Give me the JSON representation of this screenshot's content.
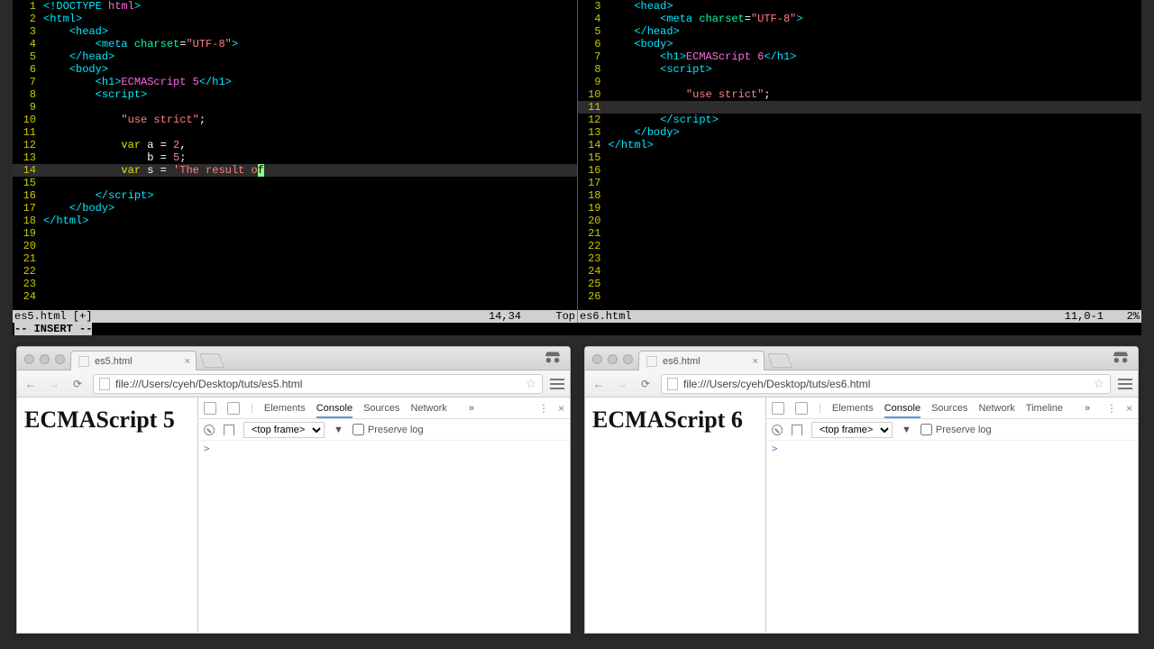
{
  "vim": {
    "left": {
      "lines": [
        {
          "n": 1,
          "html": "<span class='ang'>&lt;!</span><span class='tag'>DOCTYPE</span> <span class='mag'>html</span><span class='ang'>&gt;</span>"
        },
        {
          "n": 2,
          "html": "<span class='ang'>&lt;</span><span class='tag'>html</span><span class='ang'>&gt;</span>"
        },
        {
          "n": 3,
          "html": "    <span class='ang'>&lt;</span><span class='tag'>head</span><span class='ang'>&gt;</span>"
        },
        {
          "n": 4,
          "html": "        <span class='ang'>&lt;</span><span class='tag'>meta</span> <span class='attr'>charset</span><span class='white'>=</span><span class='str'>\"UTF-8\"</span><span class='ang'>&gt;</span>"
        },
        {
          "n": 5,
          "html": "    <span class='ang'>&lt;/</span><span class='tag'>head</span><span class='ang'>&gt;</span>"
        },
        {
          "n": 6,
          "html": "    <span class='ang'>&lt;</span><span class='tag'>body</span><span class='ang'>&gt;</span>"
        },
        {
          "n": 7,
          "html": "        <span class='ang'>&lt;</span><span class='tag'>h1</span><span class='ang'>&gt;</span><span class='mag'>ECMAScript 5</span><span class='ang'>&lt;/</span><span class='tag'>h1</span><span class='ang'>&gt;</span>"
        },
        {
          "n": 8,
          "html": "        <span class='ang'>&lt;</span><span class='tag'>script</span><span class='ang'>&gt;</span>"
        },
        {
          "n": 9,
          "html": ""
        },
        {
          "n": 10,
          "html": "            <span class='str'>\"use strict\"</span><span class='white'>;</span>"
        },
        {
          "n": 11,
          "html": ""
        },
        {
          "n": 12,
          "html": "            <span class='kw'>var</span> <span class='white'>a</span> <span class='op'>=</span> <span class='num'>2</span><span class='white'>,</span>"
        },
        {
          "n": 13,
          "html": "                <span class='white'>b</span> <span class='op'>=</span> <span class='num'>5</span><span class='white'>;</span>"
        },
        {
          "n": 14,
          "hl": true,
          "html": "            <span class='kw'>var</span> <span class='white'>s</span> <span class='op'>=</span> <span class='str'>'The result o</span><span class='cursor'>f</span>"
        },
        {
          "n": 15,
          "html": ""
        },
        {
          "n": 16,
          "html": "        <span class='ang'>&lt;/</span><span class='tag'>script</span><span class='ang'>&gt;</span>"
        },
        {
          "n": 17,
          "html": "    <span class='ang'>&lt;/</span><span class='tag'>body</span><span class='ang'>&gt;</span>"
        },
        {
          "n": 18,
          "html": "<span class='ang'>&lt;/</span><span class='tag'>html</span><span class='ang'>&gt;</span>"
        },
        {
          "n": 19,
          "html": ""
        },
        {
          "n": 20,
          "html": ""
        },
        {
          "n": 21,
          "html": ""
        },
        {
          "n": 22,
          "html": ""
        },
        {
          "n": 23,
          "html": ""
        },
        {
          "n": 24,
          "html": ""
        }
      ],
      "status_file": "es5.html  [+]",
      "status_pos": "14,34",
      "status_pct": "Top"
    },
    "right": {
      "lines": [
        {
          "n": 3,
          "html": "    <span class='ang'>&lt;</span><span class='tag'>head</span><span class='ang'>&gt;</span>"
        },
        {
          "n": 4,
          "html": "        <span class='ang'>&lt;</span><span class='tag'>meta</span> <span class='attr'>charset</span><span class='white'>=</span><span class='str'>\"UTF-8\"</span><span class='ang'>&gt;</span>"
        },
        {
          "n": 5,
          "html": "    <span class='ang'>&lt;/</span><span class='tag'>head</span><span class='ang'>&gt;</span>"
        },
        {
          "n": 6,
          "html": "    <span class='ang'>&lt;</span><span class='tag'>body</span><span class='ang'>&gt;</span>"
        },
        {
          "n": 7,
          "html": "        <span class='ang'>&lt;</span><span class='tag'>h1</span><span class='ang'>&gt;</span><span class='mag'>ECMAScript 6</span><span class='ang'>&lt;/</span><span class='tag'>h1</span><span class='ang'>&gt;</span>"
        },
        {
          "n": 8,
          "html": "        <span class='ang'>&lt;</span><span class='tag'>script</span><span class='ang'>&gt;</span>"
        },
        {
          "n": 9,
          "html": ""
        },
        {
          "n": 10,
          "html": "            <span class='str'>\"use strict\"</span><span class='white'>;</span>"
        },
        {
          "n": 11,
          "hl": true,
          "html": ""
        },
        {
          "n": 12,
          "html": "        <span class='ang'>&lt;/</span><span class='tag'>script</span><span class='ang'>&gt;</span>"
        },
        {
          "n": 13,
          "html": "    <span class='ang'>&lt;/</span><span class='tag'>body</span><span class='ang'>&gt;</span>"
        },
        {
          "n": 14,
          "html": "<span class='ang'>&lt;/</span><span class='tag'>html</span><span class='ang'>&gt;</span>"
        },
        {
          "n": 15,
          "html": ""
        },
        {
          "n": 16,
          "html": ""
        },
        {
          "n": 17,
          "html": ""
        },
        {
          "n": 18,
          "html": ""
        },
        {
          "n": 19,
          "html": ""
        },
        {
          "n": 20,
          "html": ""
        },
        {
          "n": 21,
          "html": ""
        },
        {
          "n": 22,
          "html": ""
        },
        {
          "n": 23,
          "html": ""
        },
        {
          "n": 24,
          "html": ""
        },
        {
          "n": 25,
          "html": ""
        },
        {
          "n": 26,
          "html": ""
        }
      ],
      "status_file": "es6.html",
      "status_pos": "11,0-1",
      "status_pct": "2%"
    },
    "mode": "-- INSERT --"
  },
  "chrome_left": {
    "tab_title": "es5.html",
    "url": "file:///Users/cyeh/Desktop/tuts/es5.html",
    "page_h1": "ECMAScript 5",
    "devtools": {
      "tabs": [
        "Elements",
        "Console",
        "Sources",
        "Network"
      ],
      "active": "Console",
      "more": "»",
      "frame": "<top frame>",
      "preserve": "Preserve log",
      "prompt": ">"
    }
  },
  "chrome_right": {
    "tab_title": "es6.html",
    "url": "file:///Users/cyeh/Desktop/tuts/es6.html",
    "page_h1": "ECMAScript 6",
    "devtools": {
      "tabs": [
        "Elements",
        "Console",
        "Sources",
        "Network",
        "Timeline"
      ],
      "active": "Console",
      "more": "»",
      "frame": "<top frame>",
      "preserve": "Preserve log",
      "prompt": ">"
    }
  }
}
